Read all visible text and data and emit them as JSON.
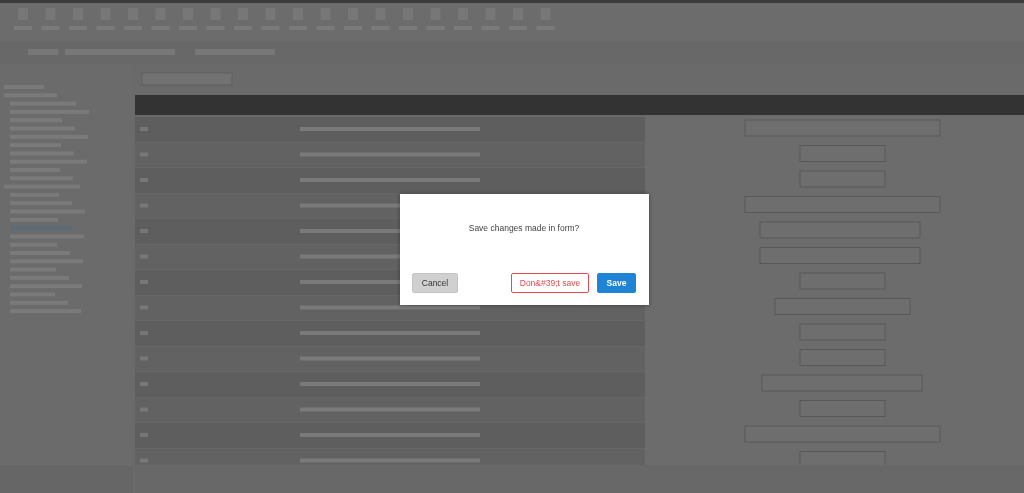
{
  "dialog": {
    "message": "Save changes made in form?",
    "buttons": [
      {
        "label": "Cancel",
        "kind": "neutral"
      },
      {
        "label": "Don&#39;t save",
        "kind": "danger"
      },
      {
        "label": "Save",
        "kind": "primary"
      }
    ]
  }
}
